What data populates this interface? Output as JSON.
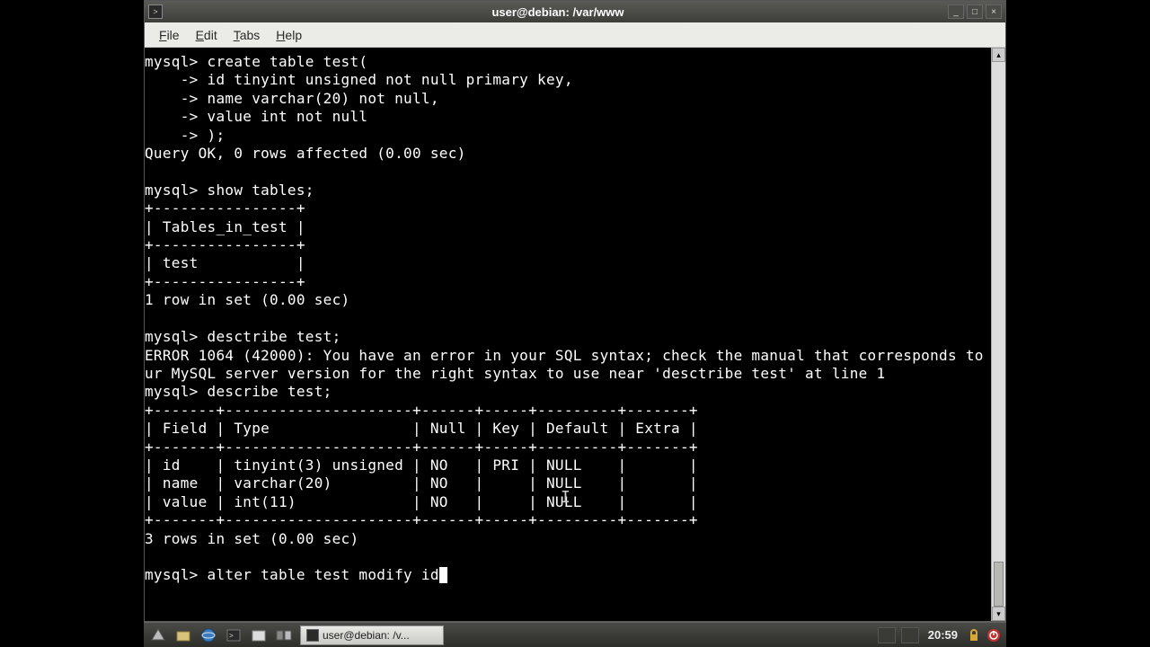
{
  "window": {
    "title": "user@debian: /var/www",
    "min": "_",
    "max": "□",
    "close": "×"
  },
  "menubar": {
    "file": "File",
    "edit": "Edit",
    "tabs": "Tabs",
    "help": "Help"
  },
  "terminal": {
    "content": "mysql> create table test(\n    -> id tinyint unsigned not null primary key,\n    -> name varchar(20) not null,\n    -> value int not null\n    -> );\nQuery OK, 0 rows affected (0.00 sec)\n\nmysql> show tables;\n+----------------+\n| Tables_in_test |\n+----------------+\n| test           |\n+----------------+\n1 row in set (0.00 sec)\n\nmysql> desctribe test;\nERROR 1064 (42000): You have an error in your SQL syntax; check the manual that corresponds to yo\nur MySQL server version for the right syntax to use near 'desctribe test' at line 1\nmysql> describe test;\n+-------+---------------------+------+-----+---------+-------+\n| Field | Type                | Null | Key | Default | Extra |\n+-------+---------------------+------+-----+---------+-------+\n| id    | tinyint(3) unsigned | NO   | PRI | NULL    |       |\n| name  | varchar(20)         | NO   |     | NULL    |       |\n| value | int(11)             | NO   |     | NULL    |       |\n+-------+---------------------+------+-----+---------+-------+\n3 rows in set (0.00 sec)\n\nmysql> alter table test modify id"
  },
  "taskbar": {
    "task_label": "user@debian: /v...",
    "clock": "20:59"
  }
}
